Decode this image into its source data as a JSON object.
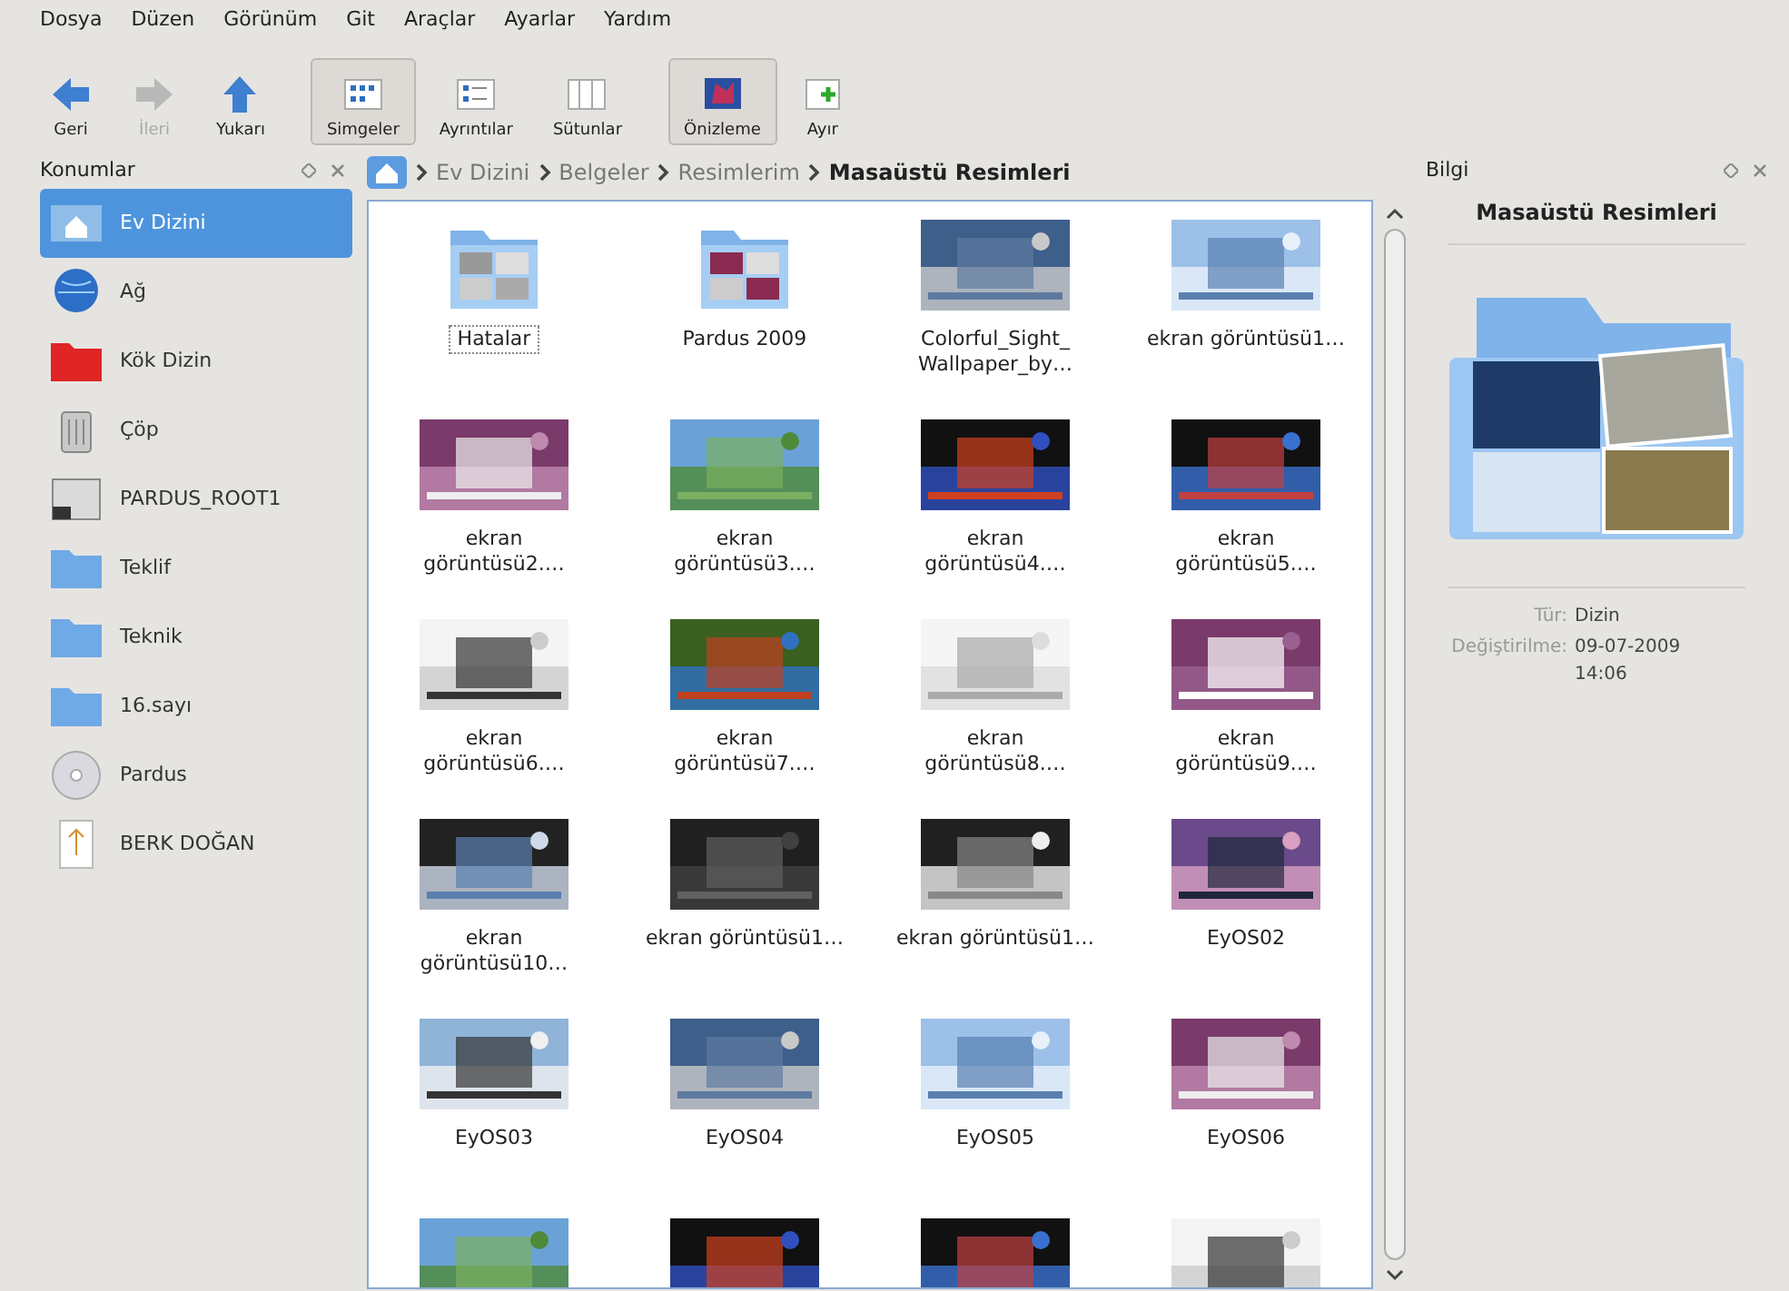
{
  "menu": [
    "Dosya",
    "Düzen",
    "Görünüm",
    "Git",
    "Araçlar",
    "Ayarlar",
    "Yardım"
  ],
  "toolbar": [
    {
      "kind": "back",
      "label": "Geri",
      "disabled": false,
      "selected": false
    },
    {
      "kind": "forward",
      "label": "İleri",
      "disabled": true,
      "selected": false
    },
    {
      "kind": "up",
      "label": "Yukarı",
      "disabled": false,
      "selected": false
    },
    {
      "kind": "icons",
      "label": "Simgeler",
      "disabled": false,
      "selected": true
    },
    {
      "kind": "details",
      "label": "Ayrıntılar",
      "disabled": false,
      "selected": false
    },
    {
      "kind": "columns",
      "label": "Sütunlar",
      "disabled": false,
      "selected": false
    },
    {
      "kind": "preview",
      "label": "Önizleme",
      "disabled": false,
      "selected": true
    },
    {
      "kind": "split",
      "label": "Ayır",
      "disabled": false,
      "selected": false
    }
  ],
  "places": {
    "title": "Konumlar",
    "items": [
      {
        "kind": "home",
        "label": "Ev Dizini",
        "selected": true
      },
      {
        "kind": "globe",
        "label": "Ağ",
        "selected": false
      },
      {
        "kind": "redfolder",
        "label": "Kök Dizin",
        "selected": false
      },
      {
        "kind": "trash",
        "label": "Çöp",
        "selected": false
      },
      {
        "kind": "drive",
        "label": "PARDUS_ROOT1",
        "selected": false
      },
      {
        "kind": "folder",
        "label": "Teklif",
        "selected": false
      },
      {
        "kind": "folder",
        "label": "Teknik",
        "selected": false
      },
      {
        "kind": "folder",
        "label": "16.sayı",
        "selected": false
      },
      {
        "kind": "disc",
        "label": "Pardus",
        "selected": false
      },
      {
        "kind": "usb",
        "label": "BERK DOĞAN",
        "selected": false
      }
    ]
  },
  "breadcrumb": [
    "Ev Dizini",
    "Belgeler",
    "Resimlerim",
    "Masaüstü Resimleri"
  ],
  "files": [
    {
      "kind": "folder",
      "name": "Hatalar",
      "focused": true
    },
    {
      "kind": "folder",
      "name": "Pardus 2009",
      "focused": false
    },
    {
      "kind": "picture",
      "name": "Colorful_Sight_ Wallpaper_by…",
      "focused": false
    },
    {
      "kind": "picture",
      "name": "ekran görüntüsü1…",
      "focused": false
    },
    {
      "kind": "picture",
      "name": "ekran görüntüsü2.…",
      "focused": false
    },
    {
      "kind": "picture",
      "name": "ekran görüntüsü3.…",
      "focused": false
    },
    {
      "kind": "picture",
      "name": "ekran görüntüsü4.…",
      "focused": false
    },
    {
      "kind": "picture",
      "name": "ekran görüntüsü5.…",
      "focused": false
    },
    {
      "kind": "picture",
      "name": "ekran görüntüsü6.…",
      "focused": false
    },
    {
      "kind": "picture",
      "name": "ekran görüntüsü7.…",
      "focused": false
    },
    {
      "kind": "picture",
      "name": "ekran görüntüsü8.…",
      "focused": false
    },
    {
      "kind": "picture",
      "name": "ekran görüntüsü9.…",
      "focused": false
    },
    {
      "kind": "picture",
      "name": "ekran görüntüsü10…",
      "focused": false
    },
    {
      "kind": "picture",
      "name": "ekran görüntüsü1…",
      "focused": false
    },
    {
      "kind": "picture",
      "name": "ekran görüntüsü1…",
      "focused": false
    },
    {
      "kind": "picture",
      "name": "EyOS02",
      "focused": false
    },
    {
      "kind": "picture",
      "name": "EyOS03",
      "focused": false
    },
    {
      "kind": "picture",
      "name": "EyOS04",
      "focused": false
    },
    {
      "kind": "picture",
      "name": "EyOS05",
      "focused": false
    },
    {
      "kind": "picture",
      "name": "EyOS06",
      "focused": false
    },
    {
      "kind": "picture"
    },
    {
      "kind": "picture"
    },
    {
      "kind": "picture"
    },
    {
      "kind": "picture"
    }
  ],
  "info": {
    "title": "Bilgi",
    "heading": "Masaüstü Resimleri",
    "fields": [
      {
        "label": "Tür:",
        "value": "Dizin"
      },
      {
        "label": "Değiştirilme:",
        "value": "09-07-2009 14:06"
      }
    ]
  }
}
